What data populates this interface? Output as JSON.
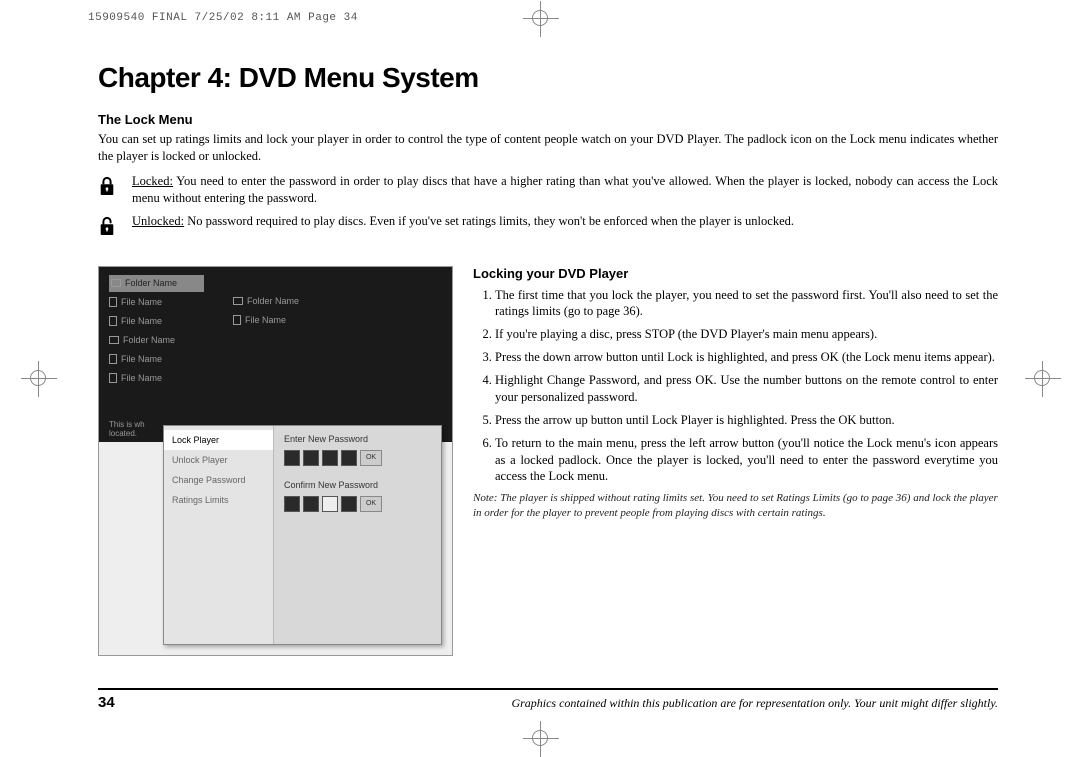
{
  "header": {
    "meta": "15909540 FINAL  7/25/02  8:11 AM  Page 34"
  },
  "chapter": {
    "title": "Chapter 4: DVD Menu System"
  },
  "lock_menu": {
    "title": "The Lock Menu",
    "intro": "You can set up ratings limits and lock your player in order to control the type of content people watch on your DVD Player. The padlock icon on the Lock menu indicates whether the player is locked or unlocked.",
    "locked_label": "Locked:",
    "locked_text": " You need to enter the password in order to play discs that have a higher rating than what you've allowed. When the player is locked, nobody can access the Lock menu without entering the password.",
    "unlocked_label": "Unlocked:",
    "unlocked_text": " No password required to play discs. Even if you've set ratings limits, they won't be enforced when the player is unlocked."
  },
  "screenshot": {
    "folder_name": "Folder Name",
    "file_name": "File Name",
    "footer1": "This is wh",
    "footer2": "located.",
    "dialog": {
      "items": [
        "Lock Player",
        "Unlock Player",
        "Change Password",
        "Ratings Limits"
      ],
      "enter_label": "Enter New Password",
      "confirm_label": "Confirm New Password",
      "ok": "OK"
    }
  },
  "locking": {
    "title": "Locking your DVD Player",
    "steps": [
      "The first time that you lock the player, you need to set the password first. You'll also need to set the ratings limits (go to page 36).",
      "If you're playing a disc, press STOP (the DVD Player's main menu appears).",
      "Press the down arrow button until Lock is highlighted, and press OK (the Lock menu items appear).",
      "Highlight Change Password, and press OK. Use the number buttons on the remote control to enter your personalized password.",
      "Press the arrow up button until Lock Player is highlighted. Press the OK button.",
      "To return to the main menu, press the left arrow button (you'll notice the Lock menu's icon appears as a locked padlock. Once the player is locked, you'll need to enter the password everytime you access the Lock menu."
    ],
    "note": "Note: The player is shipped without rating limits set. You need to set Ratings Limits (go to page 36) and lock the player in order for the player to prevent people from playing discs with certain ratings."
  },
  "footer": {
    "page": "34",
    "text": "Graphics contained within this publication are for representation only. Your unit might differ slightly."
  }
}
